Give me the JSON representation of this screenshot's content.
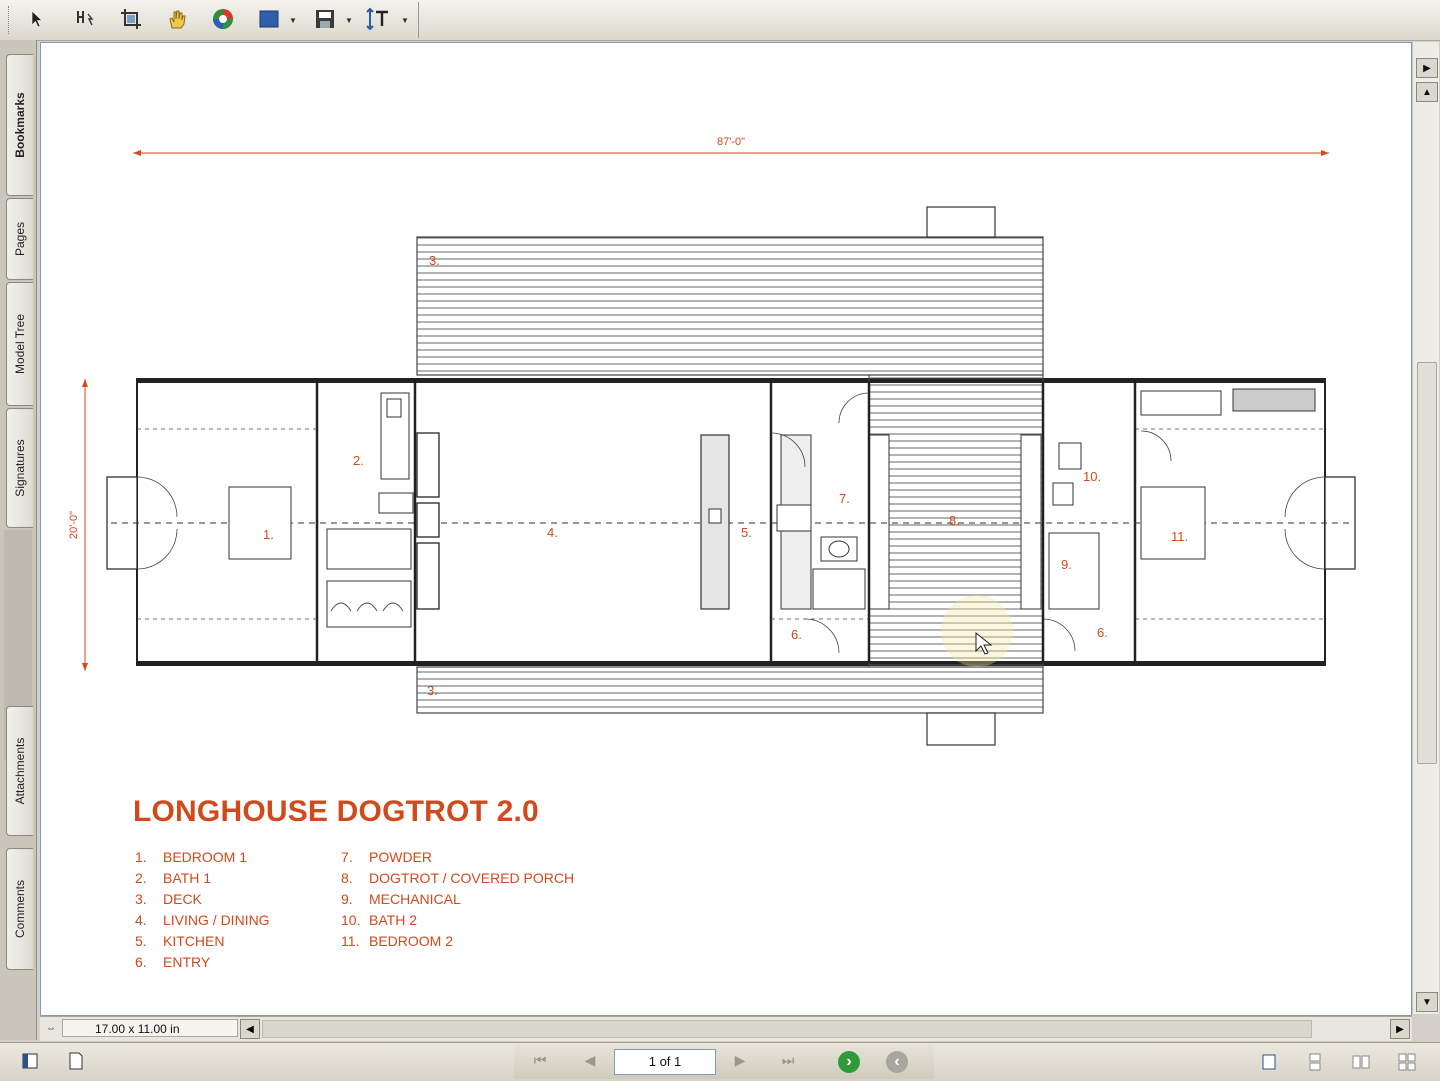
{
  "toolbar": {
    "tools": [
      {
        "name": "select-tool-icon"
      },
      {
        "name": "text-select-icon"
      },
      {
        "name": "crop-icon"
      },
      {
        "name": "hand-tool-icon"
      },
      {
        "name": "rotate-view-icon"
      },
      {
        "name": "fill-area-icon"
      },
      {
        "name": "save-view-icon"
      },
      {
        "name": "measure-icon"
      }
    ]
  },
  "nav_tabs": [
    {
      "label": "Bookmarks",
      "active": true
    },
    {
      "label": "Pages"
    },
    {
      "label": "Model Tree"
    },
    {
      "label": "Signatures"
    },
    {
      "label": "Attachments"
    },
    {
      "label": "Comments"
    }
  ],
  "drawing": {
    "overall_width_dim": "87'-0\"",
    "overall_depth_dim": "20'-0\"",
    "room_tags": {
      "r1": "1.",
      "r2": "2.",
      "r3_top": "3.",
      "r3_bottom": "3.",
      "r4": "4.",
      "r5": "5.",
      "r6_left": "6.",
      "r6_right": "6.",
      "r7": "7.",
      "r8": "8.",
      "r9": "9.",
      "r10": "10.",
      "r11": "11."
    },
    "accent_color": "#d04a1c"
  },
  "sheet": {
    "title": "LONGHOUSE DOGTROT 2.0",
    "legend_left": [
      {
        "num": "1.",
        "label": "BEDROOM 1"
      },
      {
        "num": "2.",
        "label": "BATH 1"
      },
      {
        "num": "3.",
        "label": "DECK"
      },
      {
        "num": "4.",
        "label": "LIVING / DINING"
      },
      {
        "num": "5.",
        "label": "KITCHEN"
      },
      {
        "num": "6.",
        "label": "ENTRY"
      }
    ],
    "legend_right": [
      {
        "num": "7.",
        "label": "POWDER"
      },
      {
        "num": "8.",
        "label": "DOGTROT / COVERED PORCH"
      },
      {
        "num": "9.",
        "label": "MECHANICAL"
      },
      {
        "num": "10.",
        "label": "BATH 2"
      },
      {
        "num": "11.",
        "label": "BEDROOM 2"
      }
    ]
  },
  "status": {
    "page_size": "17.00 x 11.00 in",
    "page_indicator": "1 of 1"
  }
}
